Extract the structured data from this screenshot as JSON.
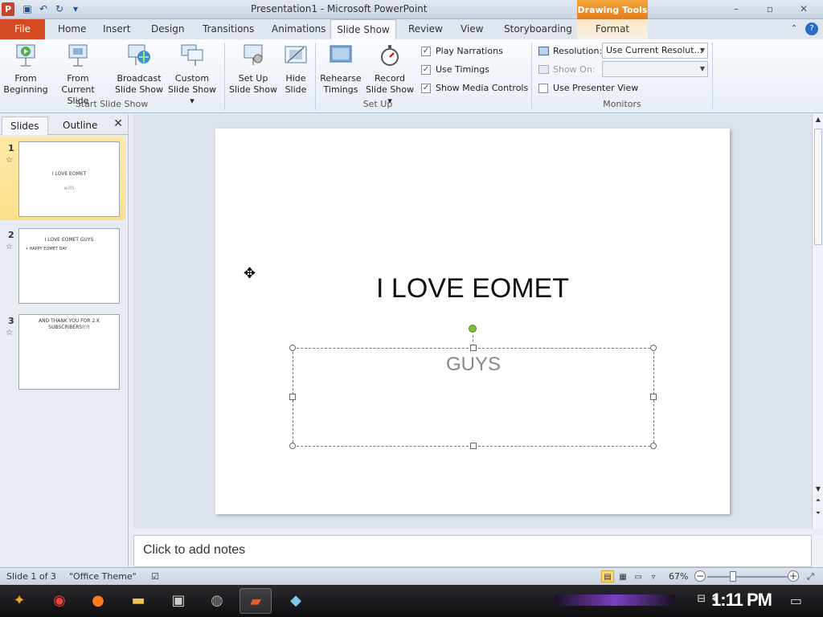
{
  "window": {
    "title": "Presentation1 - Microsoft PowerPoint",
    "context_tools": "Drawing Tools",
    "app_icon_letter": "P",
    "minimize": "–",
    "maximize": "▫",
    "close": "✕"
  },
  "tabs": {
    "file": "File",
    "items": [
      "Home",
      "Insert",
      "Design",
      "Transitions",
      "Animations",
      "Slide Show",
      "Review",
      "View",
      "Storyboarding",
      "Format"
    ]
  },
  "ribbon": {
    "start_group": {
      "label": "Start Slide Show",
      "from_beginning": [
        "From",
        "Beginning"
      ],
      "from_current": [
        "From Current",
        "Slide"
      ],
      "broadcast": [
        "Broadcast",
        "Slide Show"
      ],
      "custom": [
        "Custom",
        "Slide Show ▾"
      ]
    },
    "setup_group": {
      "label": "Set Up",
      "setup": [
        "Set Up",
        "Slide Show"
      ],
      "hide": [
        "Hide",
        "Slide"
      ],
      "rehearse": [
        "Rehearse",
        "Timings"
      ],
      "record": [
        "Record",
        "Slide Show ▾"
      ],
      "play_narrations": "Play Narrations",
      "use_timings": "Use Timings",
      "show_media_controls": "Show Media Controls"
    },
    "monitors_group": {
      "label": "Monitors",
      "resolution_label": "Resolution:",
      "resolution_value": "Use Current Resolut...",
      "show_on_label": "Show On:",
      "use_presenter_view": "Use Presenter View"
    }
  },
  "left_pane": {
    "tab_slides": "Slides",
    "tab_outline": "Outline",
    "close": "✕",
    "slides": [
      {
        "num": "1",
        "line1": "I LOVE EOMET",
        "line2": "with"
      },
      {
        "num": "2",
        "line1": "I LOVE EOMET GUYS",
        "line2": "•  HAPPY EOMET  DAY"
      },
      {
        "num": "3",
        "line1": "AND THANK YOU FOR 2.K",
        "line2": "SUBSCRIBERS!!!!"
      }
    ]
  },
  "slide": {
    "title": "I LOVE EOMET",
    "subtitle": "GUYS"
  },
  "notes": {
    "placeholder": "Click to add notes"
  },
  "status": {
    "slide_info": "Slide 1 of 3",
    "theme": "\"Office Theme\"",
    "zoom": "67%"
  },
  "taskbar": {
    "clock": "1:11 PM"
  }
}
